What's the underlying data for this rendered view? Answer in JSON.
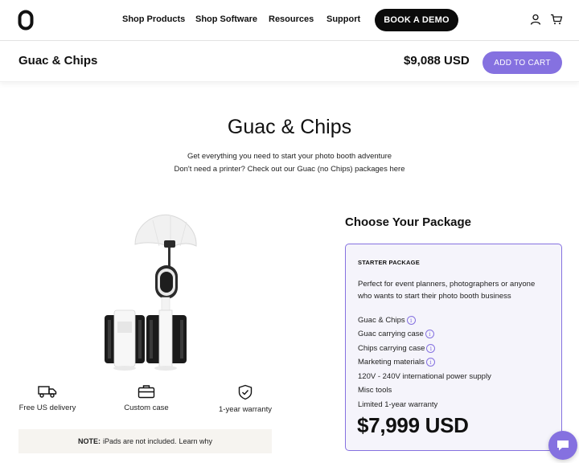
{
  "nav": {
    "links": [
      "Shop Products",
      "Shop Software",
      "Resources",
      "Support"
    ],
    "demo_label": "BOOK A DEMO",
    "icons": [
      "user-icon",
      "cart-icon"
    ]
  },
  "product_bar": {
    "title": "Guac & Chips",
    "price": "$9,088 USD",
    "cart_label": "ADD TO CART",
    "accent": "#8571e0"
  },
  "hero": {
    "title": "Guac & Chips",
    "line1": "Get everything you need to start your photo booth adventure",
    "line2": "Don't need a printer? Check out our Guac (no Chips) packages here"
  },
  "features": [
    {
      "icon": "truck-icon",
      "label": "Free US delivery"
    },
    {
      "icon": "briefcase-icon",
      "label": "Custom case"
    },
    {
      "icon": "shield-check-icon",
      "label": "1-year warranty"
    }
  ],
  "note": {
    "bold": "NOTE:",
    "text": "iPads are not included.",
    "link": "Learn why"
  },
  "package": {
    "heading": "Choose Your Package",
    "name": "STARTER PACKAGE",
    "desc1": "Perfect for event planners, photographers or anyone",
    "desc2": "who wants to start their photo booth business",
    "items": [
      {
        "label": "Guac & Chips",
        "info": true
      },
      {
        "label": "Guac carrying case",
        "info": true
      },
      {
        "label": "Chips carrying case",
        "info": true
      },
      {
        "label": "Marketing materials",
        "info": true
      },
      {
        "label": "120V - 240V international power supply",
        "info": false
      },
      {
        "label": "Misc tools",
        "info": false
      },
      {
        "label": "Limited 1-year warranty",
        "info": false
      }
    ],
    "info_glyph": "i",
    "price": "$7,999 USD"
  }
}
